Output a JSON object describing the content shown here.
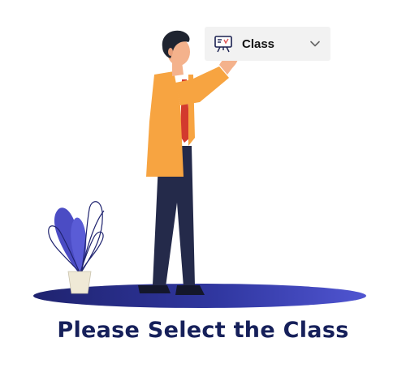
{
  "class_select": {
    "label": "Class",
    "icon": "classroom-board-icon",
    "chevron_icon": "chevron-down-icon"
  },
  "prompt": {
    "text": "Please Select the Class"
  },
  "colors": {
    "prompt_text": "#16205a",
    "jacket": "#f7a441",
    "trousers": "#242a4a",
    "tie": "#d33a2e",
    "shadow": "#3c3fa6",
    "plant_accent": "#4b4cc4",
    "select_bg": "#f2f2f2"
  }
}
